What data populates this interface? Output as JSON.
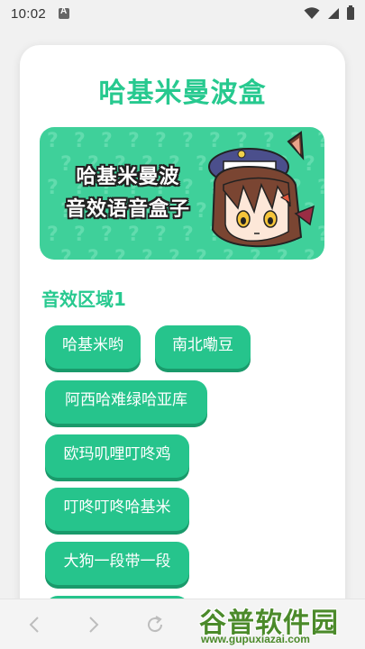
{
  "status_bar": {
    "time": "10:02"
  },
  "app": {
    "title": "哈基米曼波盒",
    "banner": {
      "line1": "哈基米曼波",
      "line2": "音效语音盒子",
      "pattern_glyph": "?"
    },
    "section_title": "音效区域1",
    "buttons": [
      "哈基米哟",
      "南北嘞豆",
      "阿西哈难绿哈亚库",
      "欧玛叽哩叮咚鸡",
      "叮咚叮咚哈基米",
      "大狗一段带一段"
    ]
  },
  "watermark": {
    "text": "谷普软件园",
    "url": "www.gupuxiazai.com"
  },
  "colors": {
    "accent": "#27c98f",
    "button": "#26c48c",
    "button_shadow": "#1a9a6b",
    "banner_bg": "#3fd09a"
  },
  "icons": {
    "nav": [
      "back-icon",
      "forward-icon",
      "refresh-icon"
    ],
    "status": [
      "app-notification-icon",
      "wifi-icon",
      "signal-icon",
      "battery-icon"
    ]
  }
}
